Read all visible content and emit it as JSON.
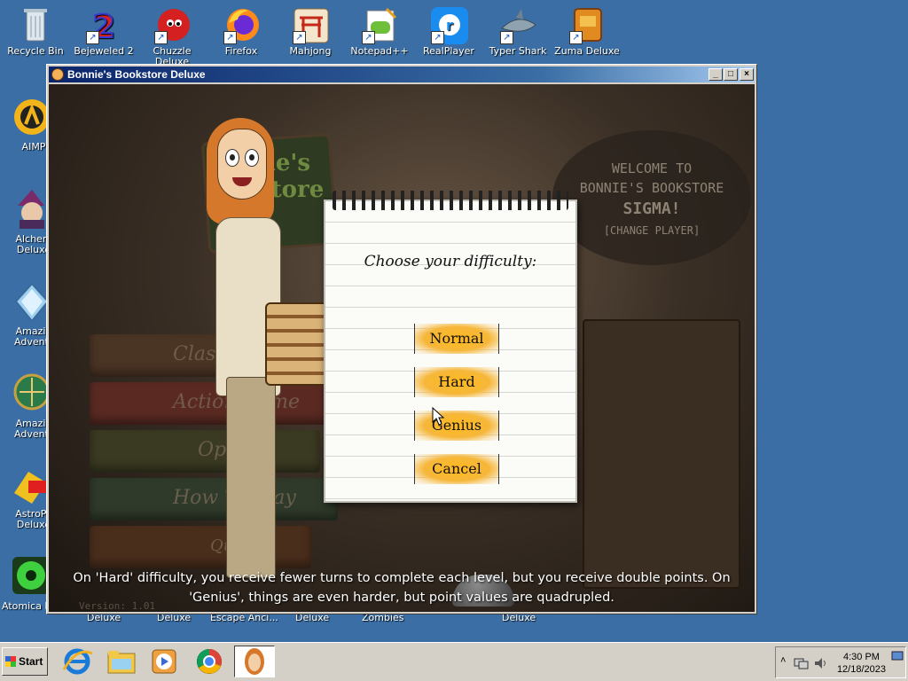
{
  "desktop": {
    "top_icons": [
      {
        "label": "Recycle Bin",
        "icon": "recycle-bin-icon"
      },
      {
        "label": "Bejeweled 2",
        "icon": "bejeweled-icon"
      },
      {
        "label": "Chuzzle Deluxe",
        "icon": "chuzzle-icon"
      },
      {
        "label": "Firefox",
        "icon": "firefox-icon"
      },
      {
        "label": "Mahjong",
        "icon": "mahjong-icon"
      },
      {
        "label": "Notepad++",
        "icon": "notepadpp-icon"
      },
      {
        "label": "RealPlayer",
        "icon": "realplayer-icon"
      },
      {
        "label": "Typer Shark",
        "icon": "typer-shark-icon"
      },
      {
        "label": "Zuma Deluxe",
        "icon": "zuma-icon"
      }
    ],
    "left_icons": [
      {
        "label": "AIMP",
        "icon": "aimp-icon"
      },
      {
        "label": "Alchem Deluxe",
        "icon": "alchemy-icon"
      },
      {
        "label": "Amazin Adventu",
        "icon": "amazing-adventures-icon"
      },
      {
        "label": "Amazin Adventu",
        "icon": "amazing-adventures-2-icon"
      },
      {
        "label": "AstroPo Deluxe",
        "icon": "astropop-icon"
      },
      {
        "label": "Atomica D",
        "icon": "atomica-icon"
      }
    ],
    "bottom_partial_labels": [
      "Deluxe",
      "Deluxe",
      "Escape Anci...",
      "Deluxe",
      "Zombies",
      "Deluxe"
    ]
  },
  "window": {
    "title": "Bonnie's Bookstore Deluxe",
    "buttons": {
      "minimize": "_",
      "maximize": "□",
      "close": "×"
    }
  },
  "game": {
    "welcome_line1": "WELCOME TO",
    "welcome_line2": "BONNIE'S BOOKSTORE",
    "player_name": "SIGMA!",
    "change_player": "[CHANGE PLAYER]",
    "sign_text_1": "ie's",
    "sign_text_2": "store",
    "menu_items": [
      "Classic",
      "Action Game",
      "Options",
      "How To Play",
      "Quit"
    ],
    "dialog": {
      "prompt": "Choose your difficulty:",
      "options": [
        "Normal",
        "Hard",
        "Genius",
        "Cancel"
      ]
    },
    "caption_line1": "On 'Hard' difficulty, you receive fewer turns to complete each level, but you receive double points.  On",
    "caption_line2": "'Genius', things are even harder, but point values are quadrupled.",
    "version_text": "Version: 1.01"
  },
  "taskbar": {
    "start_label": "Start",
    "pinned": [
      "internet-explorer-icon",
      "file-explorer-icon",
      "media-player-icon",
      "chrome-icon",
      "bonnie-game-icon"
    ],
    "time": "4:30 PM",
    "date": "12/18/2023"
  }
}
